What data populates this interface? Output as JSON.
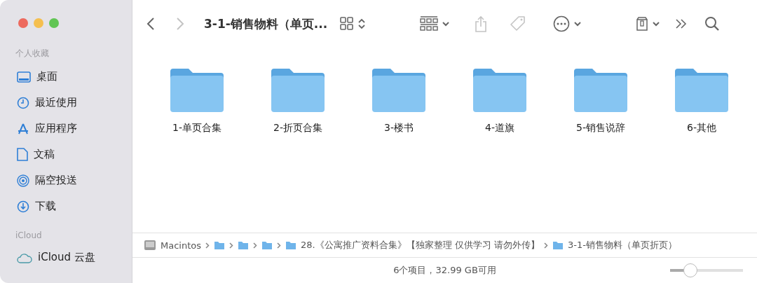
{
  "window": {
    "title": "3-1-销售物料（单页..."
  },
  "sidebar": {
    "sections": [
      {
        "heading": "个人收藏",
        "items": [
          {
            "label": "桌面",
            "kind": "desktop"
          },
          {
            "label": "最近使用",
            "kind": "clock"
          },
          {
            "label": "应用程序",
            "kind": "apps"
          },
          {
            "label": "文稿",
            "kind": "doc"
          },
          {
            "label": "隔空投送",
            "kind": "airdrop"
          },
          {
            "label": "下载",
            "kind": "download"
          }
        ]
      },
      {
        "heading": "iCloud",
        "items": [
          {
            "label": "iCloud 云盘",
            "kind": "cloud"
          }
        ]
      }
    ]
  },
  "toolbar": {
    "back": {
      "disabled": false
    },
    "forward": {
      "disabled": true
    },
    "buttons": [
      {
        "kind": "view",
        "disabled": false
      },
      {
        "kind": "group",
        "disabled": false
      },
      {
        "kind": "share",
        "disabled": true
      },
      {
        "kind": "tag",
        "disabled": true
      },
      {
        "kind": "more",
        "disabled": false
      },
      {
        "kind": "drive",
        "disabled": false
      },
      {
        "kind": "overflow",
        "disabled": false
      },
      {
        "kind": "search",
        "disabled": false
      }
    ]
  },
  "folders": [
    {
      "name": "1-单页合集"
    },
    {
      "name": "2-折页合集"
    },
    {
      "name": "3-楼书"
    },
    {
      "name": "4-道旗"
    },
    {
      "name": "5-销售说辞"
    },
    {
      "name": "6-其他"
    }
  ],
  "path_bar": [
    {
      "kind": "disk",
      "label": "Macintos"
    },
    {
      "kind": "folder"
    },
    {
      "kind": "folder"
    },
    {
      "kind": "folder"
    },
    {
      "kind": "folder",
      "label": "28.《公寓推广资料合集》【独家整理 仅供学习 请勿外传】"
    },
    {
      "kind": "folder",
      "label": "3-1-销售物料（单页折页）"
    }
  ],
  "status_bar": {
    "text": "6个项目，32.99 GB可用",
    "zoom": {
      "level": 0.28
    }
  }
}
